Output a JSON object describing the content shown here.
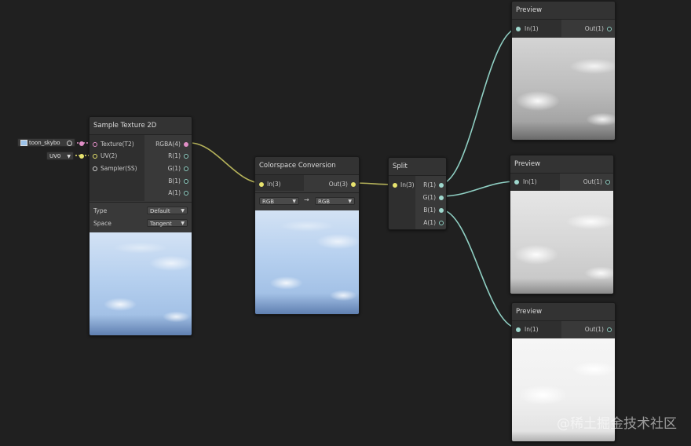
{
  "colors": {
    "canvas": "#202020",
    "node_body": "#393939",
    "wire_teal": "#8fcfc3",
    "wire_yellow": "#e7e36e",
    "port_pink": "#e08fc6"
  },
  "property_inputs": {
    "texture_name": "toon_skybo",
    "texture_icon": "texture-icon",
    "target_icon": "target-icon",
    "uv_value": "UV0"
  },
  "sample_texture": {
    "title": "Sample Texture 2D",
    "inputs": [
      "Texture(T2)",
      "UV(2)",
      "Sampler(SS)"
    ],
    "outputs": [
      "RGBA(4)",
      "R(1)",
      "G(1)",
      "B(1)",
      "A(1)"
    ],
    "type_label": "Type",
    "type_value": "Default",
    "space_label": "Space",
    "space_value": "Tangent"
  },
  "colorspace": {
    "title": "Colorspace Conversion",
    "input": "In(3)",
    "output": "Out(3)",
    "from_value": "RGB",
    "arrow": "→",
    "to_value": "RGB"
  },
  "split": {
    "title": "Split",
    "input": "In(3)",
    "outputs": [
      "R(1)",
      "G(1)",
      "B(1)",
      "A(1)"
    ]
  },
  "previews": [
    {
      "title": "Preview",
      "input": "In(1)",
      "output": "Out(1)"
    },
    {
      "title": "Preview",
      "input": "In(1)",
      "output": "Out(1)"
    },
    {
      "title": "Preview",
      "input": "In(1)",
      "output": "Out(1)"
    }
  ],
  "watermark": "@稀土掘金技术社区"
}
